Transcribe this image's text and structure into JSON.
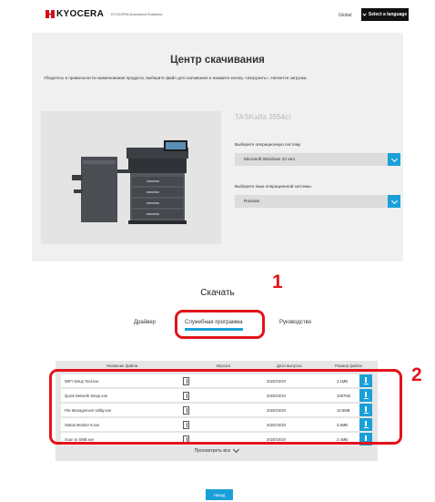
{
  "header": {
    "logo": "KYOCERA",
    "logo_sub": "KYOCERA Document Solutions",
    "global": "Global",
    "language_button": "Select a language"
  },
  "hero": {
    "title": "Центр скачивания",
    "description": "Убедитесь в правильности наименования продукта, выберите файл для скачивания и нажмите кнопку «Загрузить». Начнется загрузка.",
    "model_name": "TASKalfa 3554ci",
    "os_label": "Выберите операционную систему",
    "os_value": "Microsoft Windows 10 x64",
    "os_lang_label": "Выберите язык операционной системы",
    "os_lang_value": "Russian"
  },
  "download": {
    "title": "Скачать",
    "tabs": [
      {
        "label": "Драйвер"
      },
      {
        "label": "Служебная программа"
      },
      {
        "label": "Руководство"
      }
    ],
    "callouts": [
      "1",
      "2"
    ]
  },
  "table": {
    "headers": {
      "name": "Название файла",
      "version": "Версия",
      "date": "Дата выпуска",
      "size": "Размер файла"
    },
    "rows": [
      {
        "name": "WIFI Setup Tool.exe",
        "date": "2020/10/20",
        "size": "2.1MB"
      },
      {
        "name": "Quick Network Setup.exe",
        "date": "2020/10/20",
        "size": "3297KB"
      },
      {
        "name": "File Management Utility.exe",
        "date": "2020/10/20",
        "size": "10.5MB"
      },
      {
        "name": "Status Monitor 5.exe",
        "date": "2020/10/20",
        "size": "3.8MB"
      },
      {
        "name": "Scan to SMB.exe",
        "date": "2020/10/20",
        "size": "2.4MB"
      }
    ],
    "view_all": "Просмотреть все"
  },
  "back_button": "Назад",
  "colors": {
    "accent": "#1aa0d8",
    "callout": "#e3131b",
    "brand": "#d0121b"
  }
}
